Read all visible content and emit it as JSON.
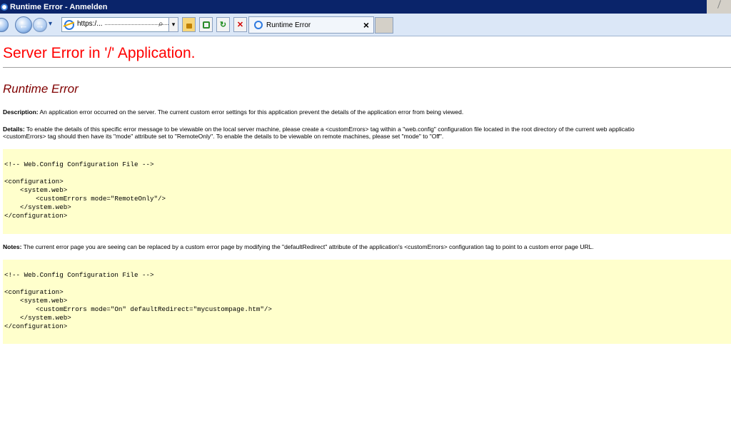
{
  "window": {
    "title": "Runtime Error - Anmelden"
  },
  "toolbar": {
    "address_text": "https:/...",
    "tab_label": "Runtime Error",
    "search_glyph": "⌕",
    "dropdown_glyph": "▾",
    "close_glyph": "✕",
    "tab_close_glyph": "×"
  },
  "page": {
    "heading": "Server Error in '/' Application.",
    "subheading": "Runtime Error",
    "description_label": "Description:",
    "description_text": " An application error occurred on the server. The current custom error settings for this application prevent the details of the application error from being viewed.",
    "details_label": "Details:",
    "details_line1": " To enable the details of this specific error message to be viewable on the local server machine, please create a <customErrors> tag within a \"web.config\" configuration file located in the root directory of the current web applicatio",
    "details_line2": "<customErrors> tag should then have its \"mode\" attribute set to \"RemoteOnly\". To enable the details to be viewable on remote machines, please set \"mode\" to \"Off\".",
    "code1": "<!-- Web.Config Configuration File -->\n\n<configuration>\n    <system.web>\n        <customErrors mode=\"RemoteOnly\"/>\n    </system.web>\n</configuration>",
    "notes_label": "Notes:",
    "notes_text": " The current error page you are seeing can be replaced by a custom error page by modifying the \"defaultRedirect\" attribute of the application's <customErrors> configuration tag to point to a custom error page URL.",
    "code2": "<!-- Web.Config Configuration File -->\n\n<configuration>\n    <system.web>\n        <customErrors mode=\"On\" defaultRedirect=\"mycustompage.htm\"/>\n    </system.web>\n</configuration>"
  },
  "colors": {
    "heading": "#ff0000",
    "subheading": "#800000",
    "code_bg": "#ffffcc",
    "titlebar": "#0a246a"
  }
}
